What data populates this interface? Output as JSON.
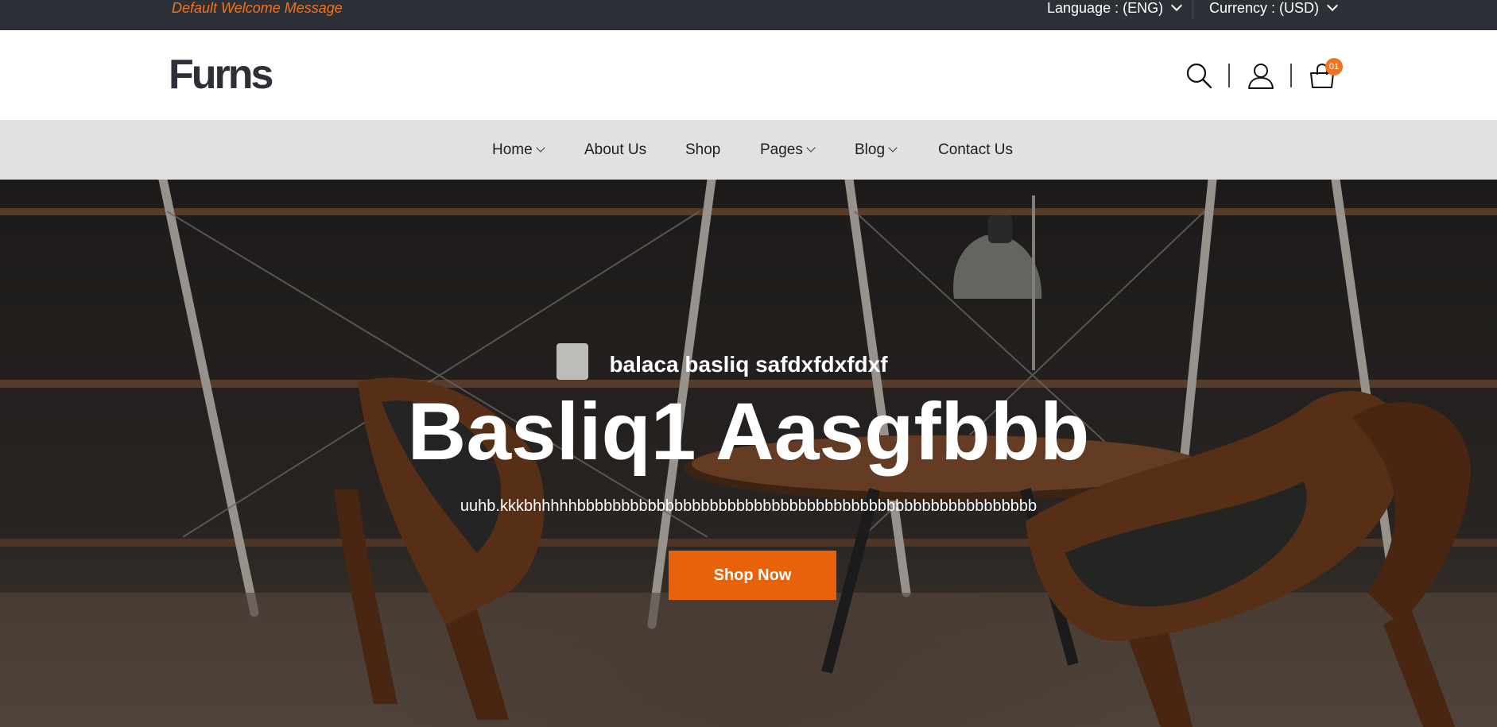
{
  "topbar": {
    "welcome": "Default Welcome Message",
    "language_label": "Language : (ENG)",
    "currency_label": "Currency : (USD)"
  },
  "header": {
    "logo": "Furns",
    "icons": [
      "search-icon",
      "user-icon",
      "cart-icon"
    ],
    "cart_count": "01"
  },
  "nav": {
    "items": [
      {
        "label": "Home",
        "dropdown": true
      },
      {
        "label": "About Us",
        "dropdown": false
      },
      {
        "label": "Shop",
        "dropdown": false
      },
      {
        "label": "Pages",
        "dropdown": true
      },
      {
        "label": "Blog",
        "dropdown": true
      },
      {
        "label": "Contact Us",
        "dropdown": false
      }
    ]
  },
  "hero": {
    "subtitle": "balaca basliq safdxfdxfdxf",
    "title": "Basliq1 Aasgfbbb",
    "description": "uuhb.kkkbhhhhhbbbbbbbbbbbbbbbbbbbbbbbbbbbbbbbbbbbbbbbbbbbbbbbbbbbb",
    "button_label": "Shop Now"
  },
  "colors": {
    "accent": "#f0731f",
    "button": "#e8620b",
    "topbar_bg": "#2d3036",
    "nav_bg": "#e1e1e1"
  }
}
